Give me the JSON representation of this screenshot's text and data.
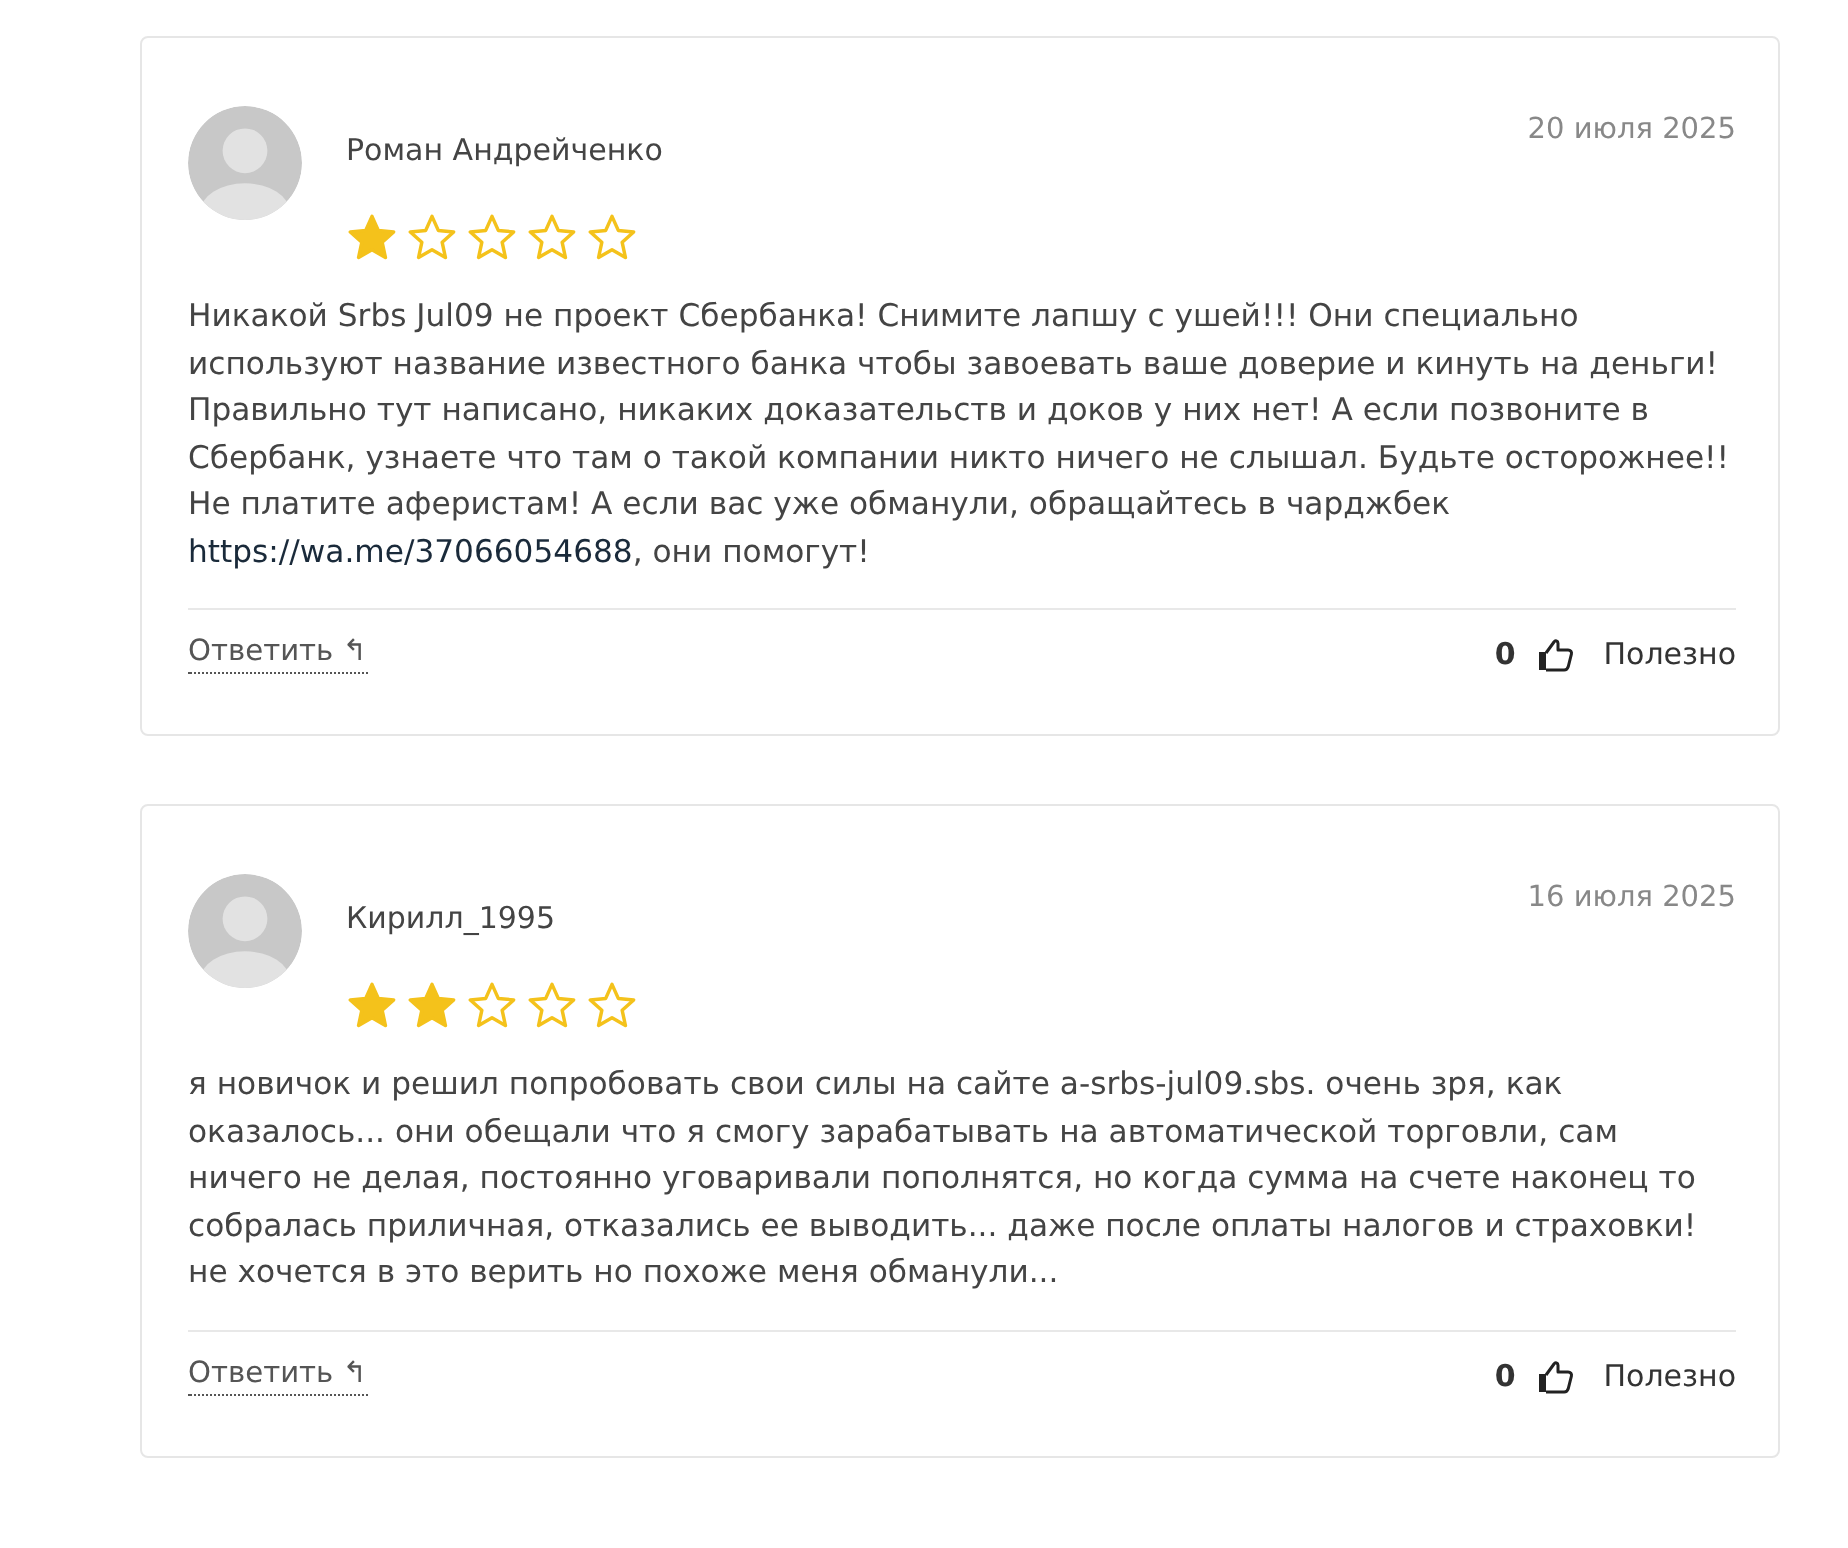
{
  "reviews": [
    {
      "author": "Роман Андрейченко",
      "date": "20 июля 2025",
      "stars": 1,
      "body": [
        {
          "kind": "text",
          "text": "Никакой Srbs Jul09 не проект Сбербанка! Снимите лапшу с ушей!!! Они специально используют название известного банка чтобы завоевать ваше доверие и кинуть на деньги! Правильно тут написано, никаких доказательств и доков у них нет! А если позвоните в Сбербанк, узнаете что там о такой компании никто ничего не слышал. Будьте осторожнее!! Не платите аферистам! А если вас уже обманули, обращайтесь в чарджбек "
        },
        {
          "kind": "link",
          "text": "https://wa.me/37066054688"
        },
        {
          "kind": "text",
          "text": ", они помогут!"
        }
      ],
      "reply": "Ответить",
      "reply_icon": "↰",
      "likes": "0",
      "helpful": "Полезно"
    },
    {
      "author": "Кирилл_1995",
      "date": "16 июля 2025",
      "stars": 2,
      "body": [
        {
          "kind": "text",
          "text": "я новичок и решил попробовать свои силы на сайте a-srbs-jul09.sbs. очень зря, как оказалось... они обещали что я смогу зарабатывать на автоматической торговли, сам ничего не делая, постоянно уговаривали пополнятся, но когда сумма на счете наконец то собралась приличная, отказались ее выводить... даже после оплаты налогов и страховки! не хочется в это верить но похоже меня обманули..."
        }
      ],
      "reply": "Ответить",
      "reply_icon": "↰",
      "likes": "0",
      "helpful": "Полезно"
    }
  ]
}
